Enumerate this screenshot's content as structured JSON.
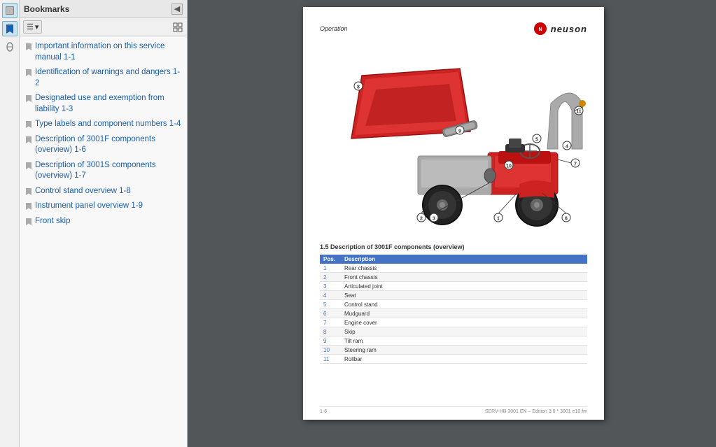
{
  "leftToolbar": {
    "icons": [
      {
        "name": "hand-tool-icon",
        "symbol": "✋"
      },
      {
        "name": "bookmark-icon",
        "symbol": "🔖"
      },
      {
        "name": "paperclip-icon",
        "symbol": "📎"
      }
    ]
  },
  "bookmarksPanel": {
    "title": "Bookmarks",
    "closeLabel": "◀",
    "toolbar": {
      "menuBtn": "☰",
      "menuArrow": "▾",
      "expandBtn": "⊞"
    },
    "items": [
      {
        "text": "Important information on this service manual 1-1"
      },
      {
        "text": "Identification of warnings and dangers 1-2"
      },
      {
        "text": "Designated use and exemption from liability 1-3"
      },
      {
        "text": "Type labels and component numbers 1-4"
      },
      {
        "text": "Description of 3001F components (overview) 1-6"
      },
      {
        "text": "Description of 3001S components (overview) 1-7"
      },
      {
        "text": "Control stand overview 1-8"
      },
      {
        "text": "Instrument panel overview 1-9"
      },
      {
        "text": "Front skip"
      }
    ]
  },
  "document": {
    "header": {
      "sectionLabel": "Operation",
      "logoAlt": "Neuson logo",
      "brandName": "neuson"
    },
    "sectionTitle": "1.5    Description of 3001F components (overview)",
    "tableHeaders": [
      "Pos.",
      "Description"
    ],
    "tableRows": [
      {
        "pos": "1",
        "desc": "Rear chassis"
      },
      {
        "pos": "2",
        "desc": "Front chassis"
      },
      {
        "pos": "3",
        "desc": "Articulated joint"
      },
      {
        "pos": "4",
        "desc": "Seat"
      },
      {
        "pos": "5",
        "desc": "Control stand"
      },
      {
        "pos": "6",
        "desc": "Mudguard"
      },
      {
        "pos": "7",
        "desc": "Engine cover"
      },
      {
        "pos": "8",
        "desc": "Skip"
      },
      {
        "pos": "9",
        "desc": "Tilt ram"
      },
      {
        "pos": "10",
        "desc": "Steering ram"
      },
      {
        "pos": "11",
        "desc": "Rollbar"
      }
    ],
    "footer": {
      "left": "1-6",
      "right": "SERV-HB 3001 EN – Edition 3.0 * 3001 e10.fm"
    }
  }
}
